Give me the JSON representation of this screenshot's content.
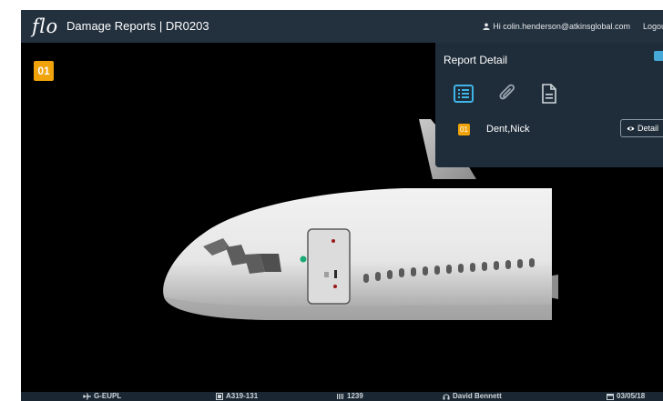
{
  "header": {
    "logo": "flo",
    "title": "Damage Reports | DR0203",
    "user": "Hi colin.henderson@atkinsglobal.com",
    "logout": "Logout"
  },
  "viewport": {
    "marker_badge": "01"
  },
  "report_panel": {
    "title": "Report Detail",
    "tabs": [
      "list-icon",
      "paperclip-icon",
      "document-icon"
    ],
    "entries": [
      {
        "badge": "01",
        "name": "Dent,Nick",
        "action": "Detail"
      }
    ]
  },
  "footer": {
    "registration": "G-EUPL",
    "aircraft_type": "A319-131",
    "number": "1239",
    "user": "David Bennett",
    "date": "03/05/18"
  },
  "colors": {
    "topbar": "#23303e",
    "panel": "#1f2d3a",
    "accent": "#45a8d8",
    "badge": "#f0a30a"
  }
}
